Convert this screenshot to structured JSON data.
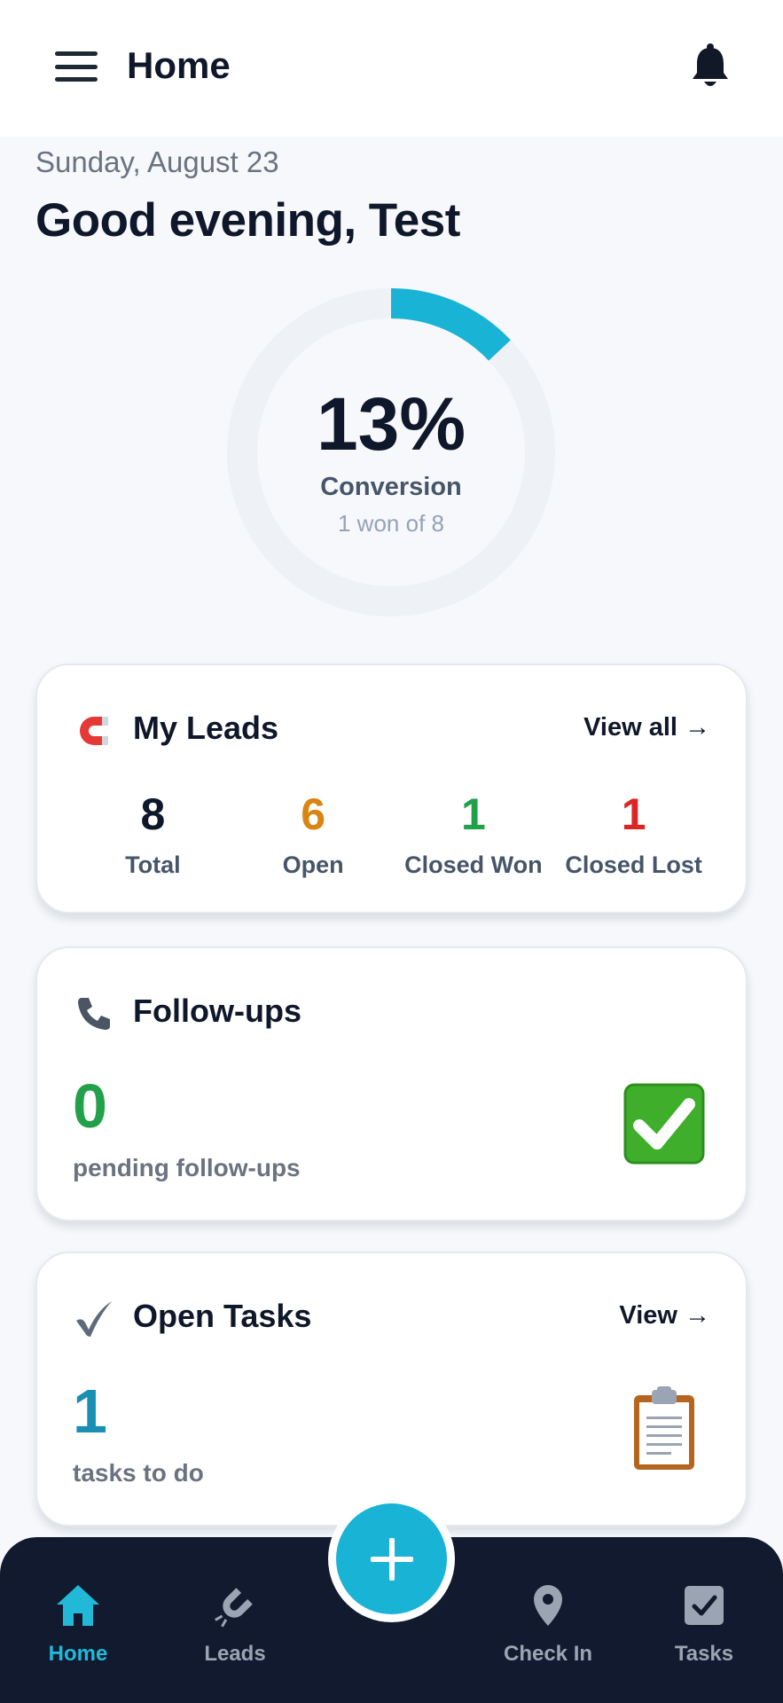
{
  "header": {
    "title": "Home"
  },
  "greeting": {
    "date": "Sunday, August 23",
    "message": "Good evening, Test"
  },
  "conversion": {
    "percent_text": "13%",
    "value": 0.13,
    "label": "Conversion",
    "sub": "1 won of 8"
  },
  "colors": {
    "accent": "#19b3d6",
    "ring_track": "#eef2f7",
    "open": "#d98413",
    "won": "#22a04a",
    "lost": "#dc2626",
    "tasks": "#1890b3",
    "nav_bg": "#111a2e"
  },
  "leads": {
    "icon": "magnet-icon",
    "title": "My Leads",
    "link": "View all →",
    "stats": [
      {
        "value": "8",
        "label": "Total"
      },
      {
        "value": "6",
        "label": "Open"
      },
      {
        "value": "1",
        "label": "Closed Won"
      },
      {
        "value": "1",
        "label": "Closed Lost"
      }
    ]
  },
  "followups": {
    "icon": "phone-icon",
    "title": "Follow-ups",
    "count": "0",
    "sub": "pending follow-ups"
  },
  "tasks": {
    "icon": "checkmark-icon",
    "title": "Open Tasks",
    "link": "View →",
    "count": "1",
    "sub": "tasks to do"
  },
  "nav": {
    "items": [
      {
        "label": "Home",
        "icon": "home-icon",
        "active": true
      },
      {
        "label": "Leads",
        "icon": "magnet-icon"
      },
      {
        "label": "Check In",
        "icon": "location-pin-icon"
      },
      {
        "label": "Tasks",
        "icon": "checkbox-icon"
      }
    ],
    "fab_icon": "plus-icon"
  }
}
